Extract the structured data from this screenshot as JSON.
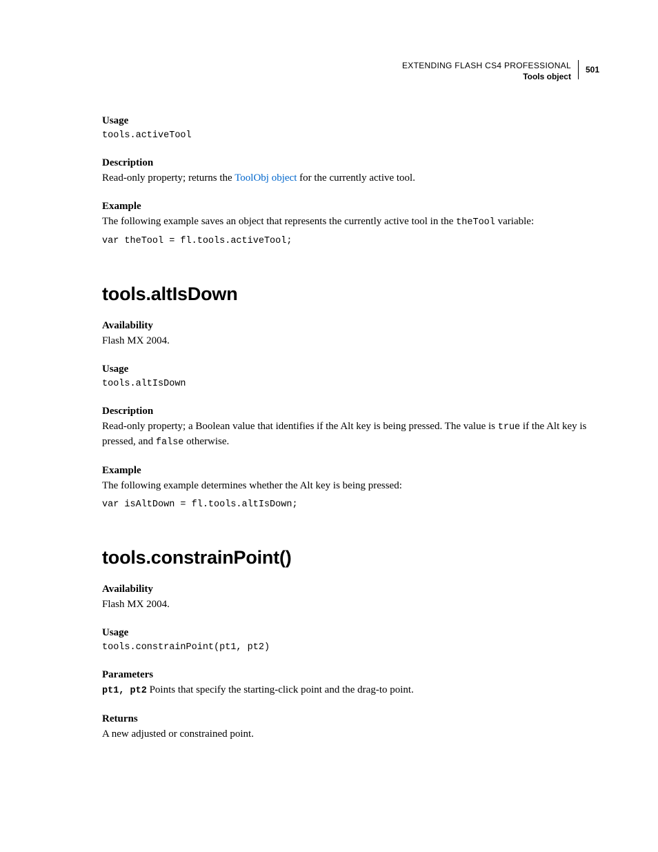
{
  "header": {
    "title": "EXTENDING FLASH CS4 PROFESSIONAL",
    "section": "Tools object",
    "page": "501"
  },
  "sec1": {
    "usage_label": "Usage",
    "usage_code": "tools.activeTool",
    "desc_label": "Description",
    "desc_pre": "Read-only property; returns the ",
    "desc_link": "ToolObj object",
    "desc_post": " for the currently active tool.",
    "ex_label": "Example",
    "ex_pre": "The following example saves an object that represents the currently active tool in the ",
    "ex_code_inline": "theTool",
    "ex_post": " variable:",
    "ex_code": "var theTool = fl.tools.activeTool;"
  },
  "sec2": {
    "heading": "tools.altIsDown",
    "avail_label": "Availability",
    "avail_text": "Flash MX 2004.",
    "usage_label": "Usage",
    "usage_code": "tools.altIsDown",
    "desc_label": "Description",
    "desc_pre": "Read-only property; a Boolean value that identifies if the Alt key is being pressed. The value is ",
    "desc_true": "true",
    "desc_mid": " if the Alt key is pressed, and ",
    "desc_false": "false",
    "desc_post": " otherwise.",
    "ex_label": "Example",
    "ex_text": "The following example determines whether the Alt key is being pressed:",
    "ex_code": "var isAltDown = fl.tools.altIsDown;"
  },
  "sec3": {
    "heading": "tools.constrainPoint()",
    "avail_label": "Availability",
    "avail_text": "Flash MX 2004.",
    "usage_label": "Usage",
    "usage_code": "tools.constrainPoint(pt1, pt2)",
    "param_label": "Parameters",
    "param_name": "pt1, pt2",
    "param_text": "  Points that specify the starting-click point and the drag-to point.",
    "ret_label": "Returns",
    "ret_text": "A new adjusted or constrained point."
  }
}
